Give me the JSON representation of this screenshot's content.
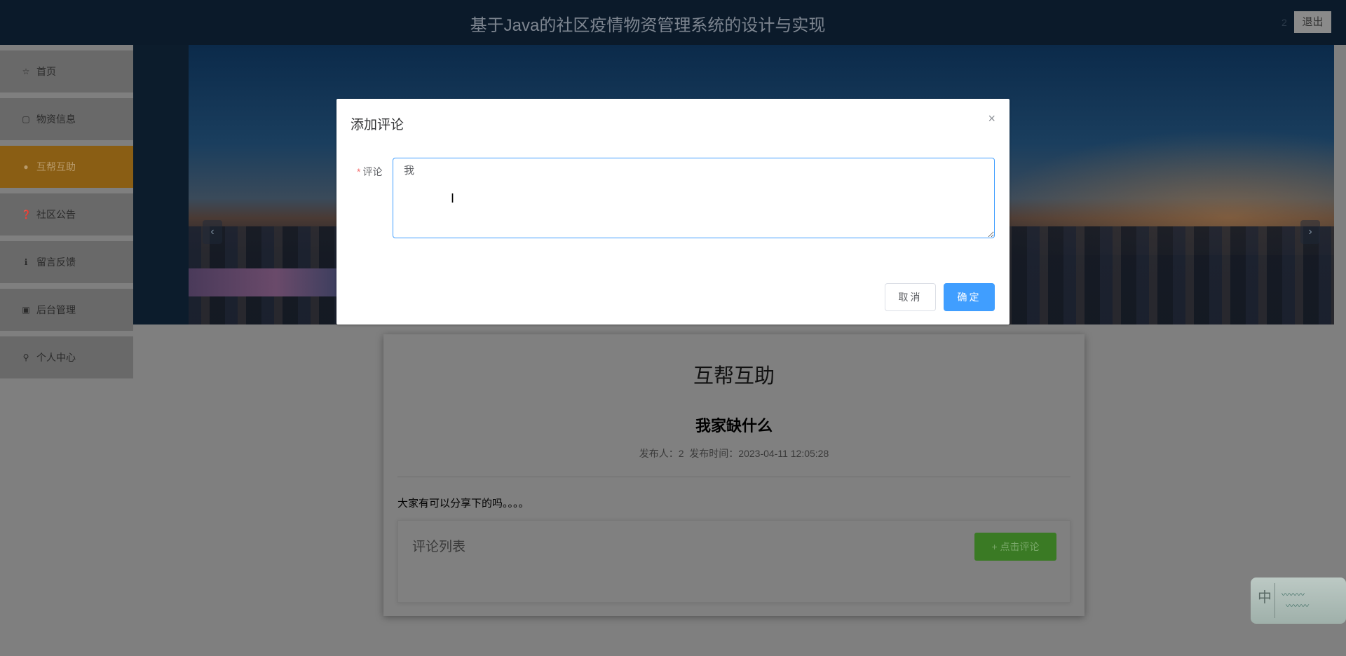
{
  "header": {
    "title": "基于Java的社区疫情物资管理系统的设计与实现",
    "username": "2",
    "logout_label": "退出"
  },
  "sidebar": {
    "items": [
      {
        "label": "首页",
        "icon": "star-icon",
        "glyph": "☆"
      },
      {
        "label": "物资信息",
        "icon": "bag-icon",
        "glyph": "▢"
      },
      {
        "label": "互帮互助",
        "icon": "info-circle-icon",
        "glyph": "●",
        "active": true
      },
      {
        "label": "社区公告",
        "icon": "question-circle-icon",
        "glyph": "❓"
      },
      {
        "label": "留言反馈",
        "icon": "info-circle-icon",
        "glyph": "ℹ"
      },
      {
        "label": "后台管理",
        "icon": "briefcase-icon",
        "glyph": "▣"
      },
      {
        "label": "个人中心",
        "icon": "user-icon",
        "glyph": "⚲"
      }
    ]
  },
  "banner": {
    "prev": "‹",
    "next": "›"
  },
  "card": {
    "title": "互帮互助",
    "post_title": "我家缺什么",
    "meta": "发布人：2  发布时间：2023-04-11 12:05:28",
    "content": "大家有可以分享下的吗。。。。",
    "comments_title": "评论列表",
    "add_comment_label": "+ 点击评论"
  },
  "dialog": {
    "title": "添加评论",
    "close": "×",
    "required_mark": "*",
    "field_label": "评论",
    "field_value": "我",
    "cancel_label": "取消",
    "ok_label": "确定"
  },
  "ime": {
    "mode": "中"
  },
  "colors": {
    "primary": "#409eff",
    "active_nav": "#e6a42a",
    "success": "#67c23a",
    "header": "#17375e"
  }
}
